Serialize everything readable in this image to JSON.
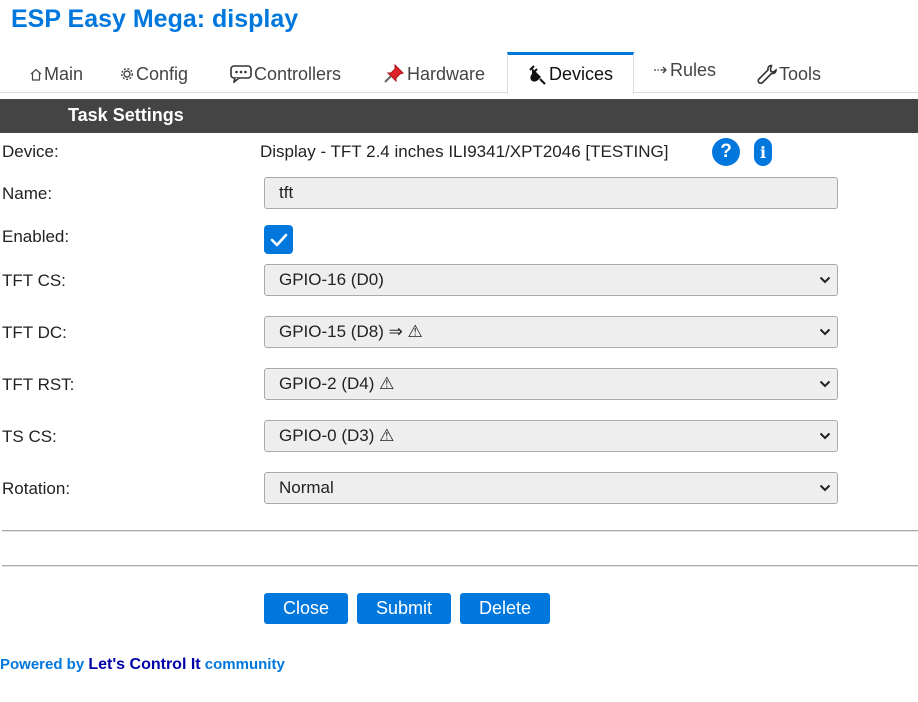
{
  "page_title": "ESP Easy Mega: display",
  "tabs": [
    {
      "label": "Main",
      "icon": "house-icon"
    },
    {
      "label": "Config",
      "icon": "gear-icon"
    },
    {
      "label": "Controllers",
      "icon": "speech-bubble-icon"
    },
    {
      "label": "Hardware",
      "icon": "pushpin-icon"
    },
    {
      "label": "Devices",
      "icon": "plug-icon",
      "active": true
    },
    {
      "label": "Rules",
      "icon": "arrow-icon"
    },
    {
      "label": "Tools",
      "icon": "wrench-icon"
    }
  ],
  "section": {
    "title": "Task Settings"
  },
  "form": {
    "device_label": "Device:",
    "device_value": "Display - TFT 2.4 inches ILI9341/XPT2046 [TESTING]",
    "help_symbol": "?",
    "info_symbol": "i",
    "name_label": "Name:",
    "name_value": "tft",
    "enabled_label": "Enabled:",
    "enabled_checked": true,
    "tft_cs_label": "TFT CS:",
    "tft_cs_value": "GPIO-16 (D0)",
    "tft_dc_label": "TFT DC:",
    "tft_dc_value": "GPIO-15 (D8) ⇒ ⚠",
    "tft_rst_label": "TFT RST:",
    "tft_rst_value": "GPIO-2 (D4) ⚠",
    "ts_cs_label": "TS CS:",
    "ts_cs_value": "GPIO-0 (D3) ⚠",
    "rotation_label": "Rotation:",
    "rotation_value": "Normal"
  },
  "buttons": {
    "close": "Close",
    "submit": "Submit",
    "delete": "Delete"
  },
  "footer": {
    "prefix": "Powered by",
    "link": "Let's Control It",
    "suffix": "community"
  },
  "colors": {
    "accent": "#0077dd",
    "section_bar": "#444444",
    "field_bg": "#eeeeee"
  }
}
